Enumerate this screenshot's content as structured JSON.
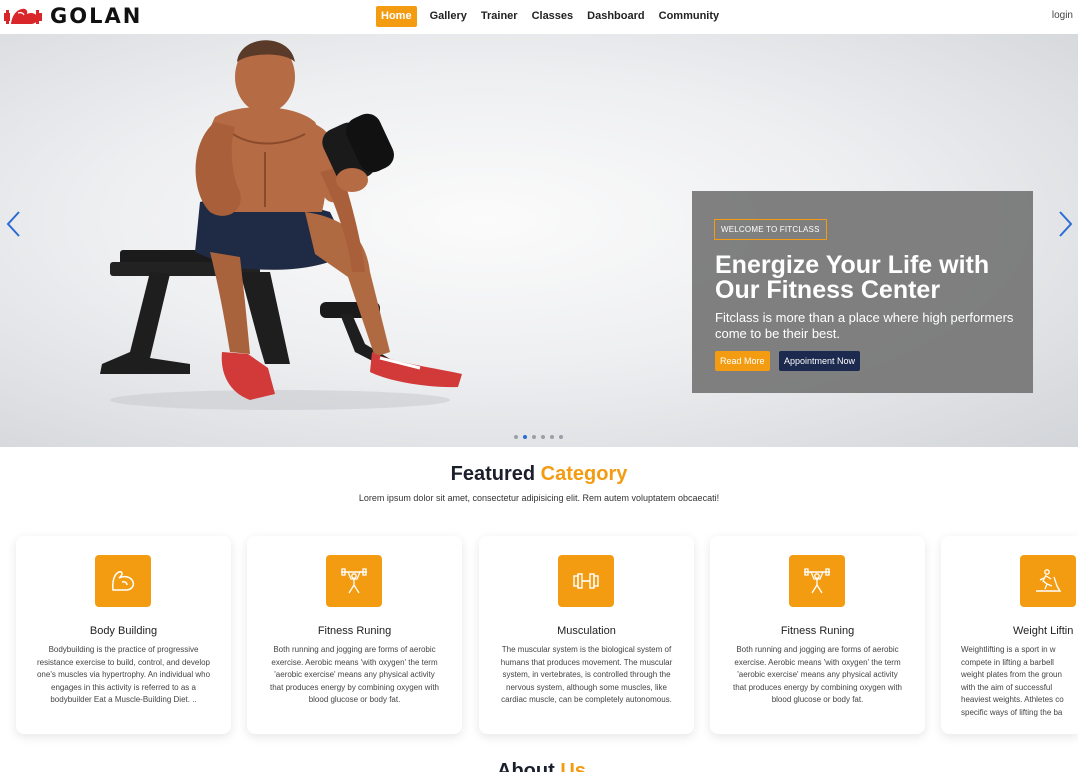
{
  "brand": {
    "name": "GOLAN",
    "logo_icon": "flexed-arm-icon"
  },
  "nav": {
    "items": [
      {
        "label": "Home",
        "active": true
      },
      {
        "label": "Gallery"
      },
      {
        "label": "Trainer"
      },
      {
        "label": "Classes"
      },
      {
        "label": "Dashboard"
      },
      {
        "label": "Community"
      }
    ],
    "login": "login"
  },
  "hero": {
    "tag": "WELCOME TO FITCLASS",
    "title": "Energize Your Life with Our Fitness Center",
    "text": "Fitclass is more than a place where high performers come to be their best.",
    "read_more": "Read More",
    "appointment": "Appointment Now",
    "slides_count": 6,
    "active_slide": 2
  },
  "featured": {
    "title_main": "Featured",
    "title_accent": "Category",
    "subtitle": "Lorem ipsum dolor sit amet, consectetur adipisicing elit. Rem autem voluptatem obcaecati!",
    "cards": [
      {
        "icon": "flexed-arm-icon",
        "title": "Body Building",
        "text": "Bodybuilding is the practice of progressive resistance exercise to build, control, and develop one's muscles via hypertrophy. An individual who engages in this activity is referred to as a bodybuilder Eat a Muscle-Building Diet. .."
      },
      {
        "icon": "weightlifter-icon",
        "title": "Fitness Runing",
        "text": "Both running and jogging are forms of aerobic exercise. Aerobic means 'with oxygen' the term 'aerobic exercise' means any physical activity that produces energy by combining oxygen with blood glucose or body fat."
      },
      {
        "icon": "dumbbell-icon",
        "title": "Musculation",
        "text": "The muscular system is the biological system of humans that produces movement. The muscular system, in vertebrates, is controlled through the nervous system, although some muscles, like cardiac muscle, can be completely autonomous."
      },
      {
        "icon": "weightlifter-icon",
        "title": "Fitness Runing",
        "text": "Both running and jogging are forms of aerobic exercise. Aerobic means 'with oxygen' the term 'aerobic exercise' means any physical activity that produces energy by combining oxygen with blood glucose or body fat."
      },
      {
        "icon": "treadmill-icon",
        "title": "Weight Liftin",
        "text": "Weightlifting is a sport in w compete in lifting a barbell weight plates from the groun with the aim of successful heaviest weights. Athletes co specific ways of lifting the ba"
      }
    ]
  },
  "about": {
    "title_main": "About",
    "title_accent": "Us"
  },
  "colors": {
    "accent": "#f39c12",
    "navy": "#1d2a4f",
    "slider_arrow": "#2b6cd4"
  }
}
